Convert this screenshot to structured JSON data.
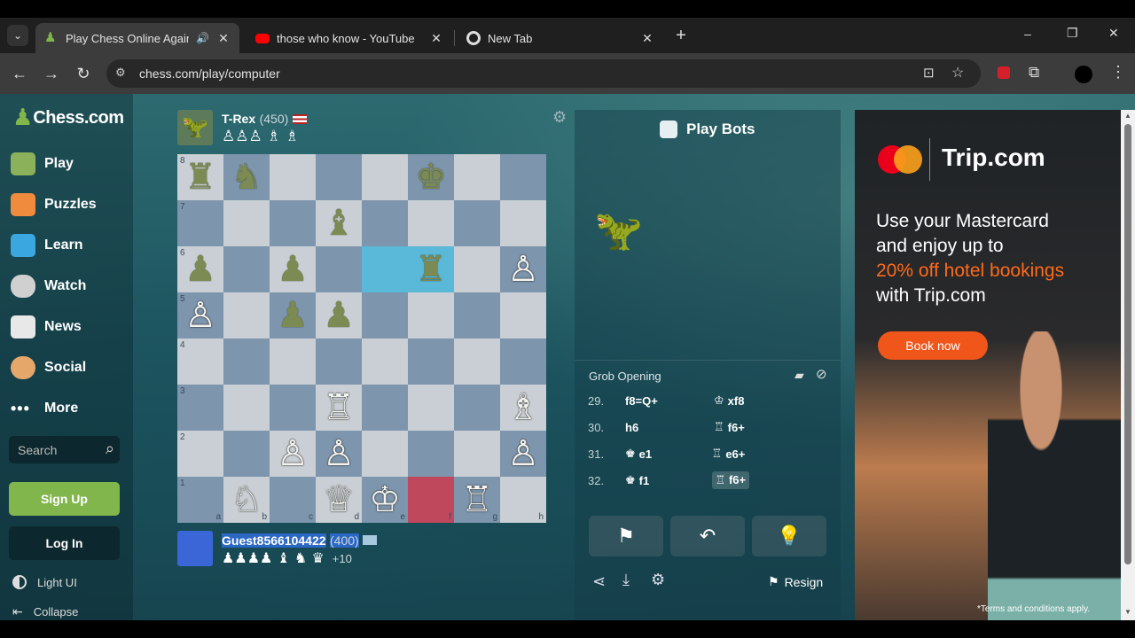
{
  "browser": {
    "tabs": [
      {
        "title": "Play Chess Online Against t",
        "active": true
      },
      {
        "title": "those who know - YouTube",
        "active": false
      },
      {
        "title": "New Tab",
        "active": false
      }
    ],
    "new_tab": "+",
    "url": "chess.com/play/computer",
    "window_controls": {
      "minimize": "–",
      "restore": "❐",
      "close": "✕"
    }
  },
  "sidebar": {
    "logo": "Chess.com",
    "items": [
      {
        "label": "Play",
        "icon": "pawn-hand-icon",
        "color": "#8bb15a"
      },
      {
        "label": "Puzzles",
        "icon": "puzzle-icon",
        "color": "#f08a3c"
      },
      {
        "label": "Learn",
        "icon": "learn-icon",
        "color": "#3aa7e0"
      },
      {
        "label": "Watch",
        "icon": "binoculars-icon",
        "color": "#d0d0d0"
      },
      {
        "label": "News",
        "icon": "news-icon",
        "color": "#e8e8e8"
      },
      {
        "label": "Social",
        "icon": "social-icon",
        "color": "#e6a76b"
      },
      {
        "label": "More",
        "icon": "more-dots-icon",
        "color": "#ffffff"
      }
    ],
    "search_placeholder": "Search",
    "signup": "Sign Up",
    "login": "Log In",
    "light_ui": "Light UI",
    "collapse": "Collapse"
  },
  "top_player": {
    "name": "T-Rex",
    "rating": "(450)",
    "captured": "♙♙♙ ♗ ♗"
  },
  "bottom_player": {
    "name": "Guest8566104422",
    "rating": "(400)",
    "captured": "♟♟♟♟ ♝ ♞ ♛",
    "advantage": "+10"
  },
  "board": {
    "files": [
      "a",
      "b",
      "c",
      "d",
      "e",
      "f",
      "g",
      "h"
    ],
    "ranks": [
      "8",
      "7",
      "6",
      "5",
      "4",
      "3",
      "2",
      "1"
    ],
    "pieces": [
      {
        "sq": "a8",
        "p": "♜",
        "c": "b"
      },
      {
        "sq": "b8",
        "p": "♞",
        "c": "b"
      },
      {
        "sq": "f8",
        "p": "♚",
        "c": "b"
      },
      {
        "sq": "d7",
        "p": "♝",
        "c": "b"
      },
      {
        "sq": "a6",
        "p": "♟",
        "c": "b"
      },
      {
        "sq": "c6",
        "p": "♟",
        "c": "b"
      },
      {
        "sq": "f6",
        "p": "♜",
        "c": "b"
      },
      {
        "sq": "h6",
        "p": "♙",
        "c": "w"
      },
      {
        "sq": "a5",
        "p": "♙",
        "c": "w"
      },
      {
        "sq": "c5",
        "p": "♟",
        "c": "b"
      },
      {
        "sq": "d5",
        "p": "♟",
        "c": "b"
      },
      {
        "sq": "d3",
        "p": "♖",
        "c": "w"
      },
      {
        "sq": "h3",
        "p": "♗",
        "c": "w"
      },
      {
        "sq": "c2",
        "p": "♙",
        "c": "w"
      },
      {
        "sq": "d2",
        "p": "♙",
        "c": "w"
      },
      {
        "sq": "h2",
        "p": "♙",
        "c": "w"
      },
      {
        "sq": "b1",
        "p": "♘",
        "c": "w"
      },
      {
        "sq": "d1",
        "p": "♕",
        "c": "w"
      },
      {
        "sq": "e1",
        "p": "♔",
        "c": "w"
      },
      {
        "sq": "g1",
        "p": "♖",
        "c": "w"
      }
    ],
    "highlights": [
      {
        "sq": "e6",
        "color": "#5ab8d8"
      },
      {
        "sq": "f6",
        "color": "#5ab8d8"
      },
      {
        "sq": "f1",
        "color": "#c0485c"
      }
    ]
  },
  "panel": {
    "title": "Play Bots",
    "opening": "Grob Opening",
    "moves": [
      {
        "num": "29.",
        "white": "f8=Q+",
        "black_icon": "♔",
        "black": "xf8"
      },
      {
        "num": "30.",
        "white": "h6",
        "black_icon": "♖",
        "black": "f6+"
      },
      {
        "num": "31.",
        "white_icon": "♚",
        "white": "e1",
        "black_icon": "♖",
        "black": "e6+"
      },
      {
        "num": "32.",
        "white_icon": "♚",
        "white": "f1",
        "black_icon": "♖",
        "black": "f6+"
      }
    ],
    "resign": "Resign"
  },
  "ad": {
    "brand": "Trip.com",
    "line1": "Use your Mastercard",
    "line2": "and enjoy up to",
    "highlight": "20% off hotel bookings",
    "line4": "with Trip.com",
    "cta": "Book now",
    "terms": "*Terms and conditions apply.",
    "accent": "#ff6a1a"
  }
}
